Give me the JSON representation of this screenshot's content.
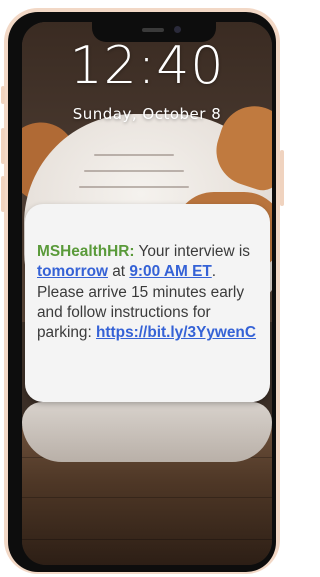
{
  "lock_screen": {
    "time": "12:40",
    "date": "Sunday, October 8"
  },
  "notification": {
    "sender": "MSHealthHR:",
    "text_part1": " Your interview is ",
    "link_day": "tomorrow",
    "text_part2": " at ",
    "link_time": "9:00 AM ET",
    "text_part3": ". Please arrive 15 minutes early and follow instructions for parking: ",
    "link_url": "https://bit.ly/3YywenC"
  },
  "colors": {
    "sender": "#5a9a3a",
    "link": "#3562d6",
    "notification_bg": "#f4f4f4"
  }
}
